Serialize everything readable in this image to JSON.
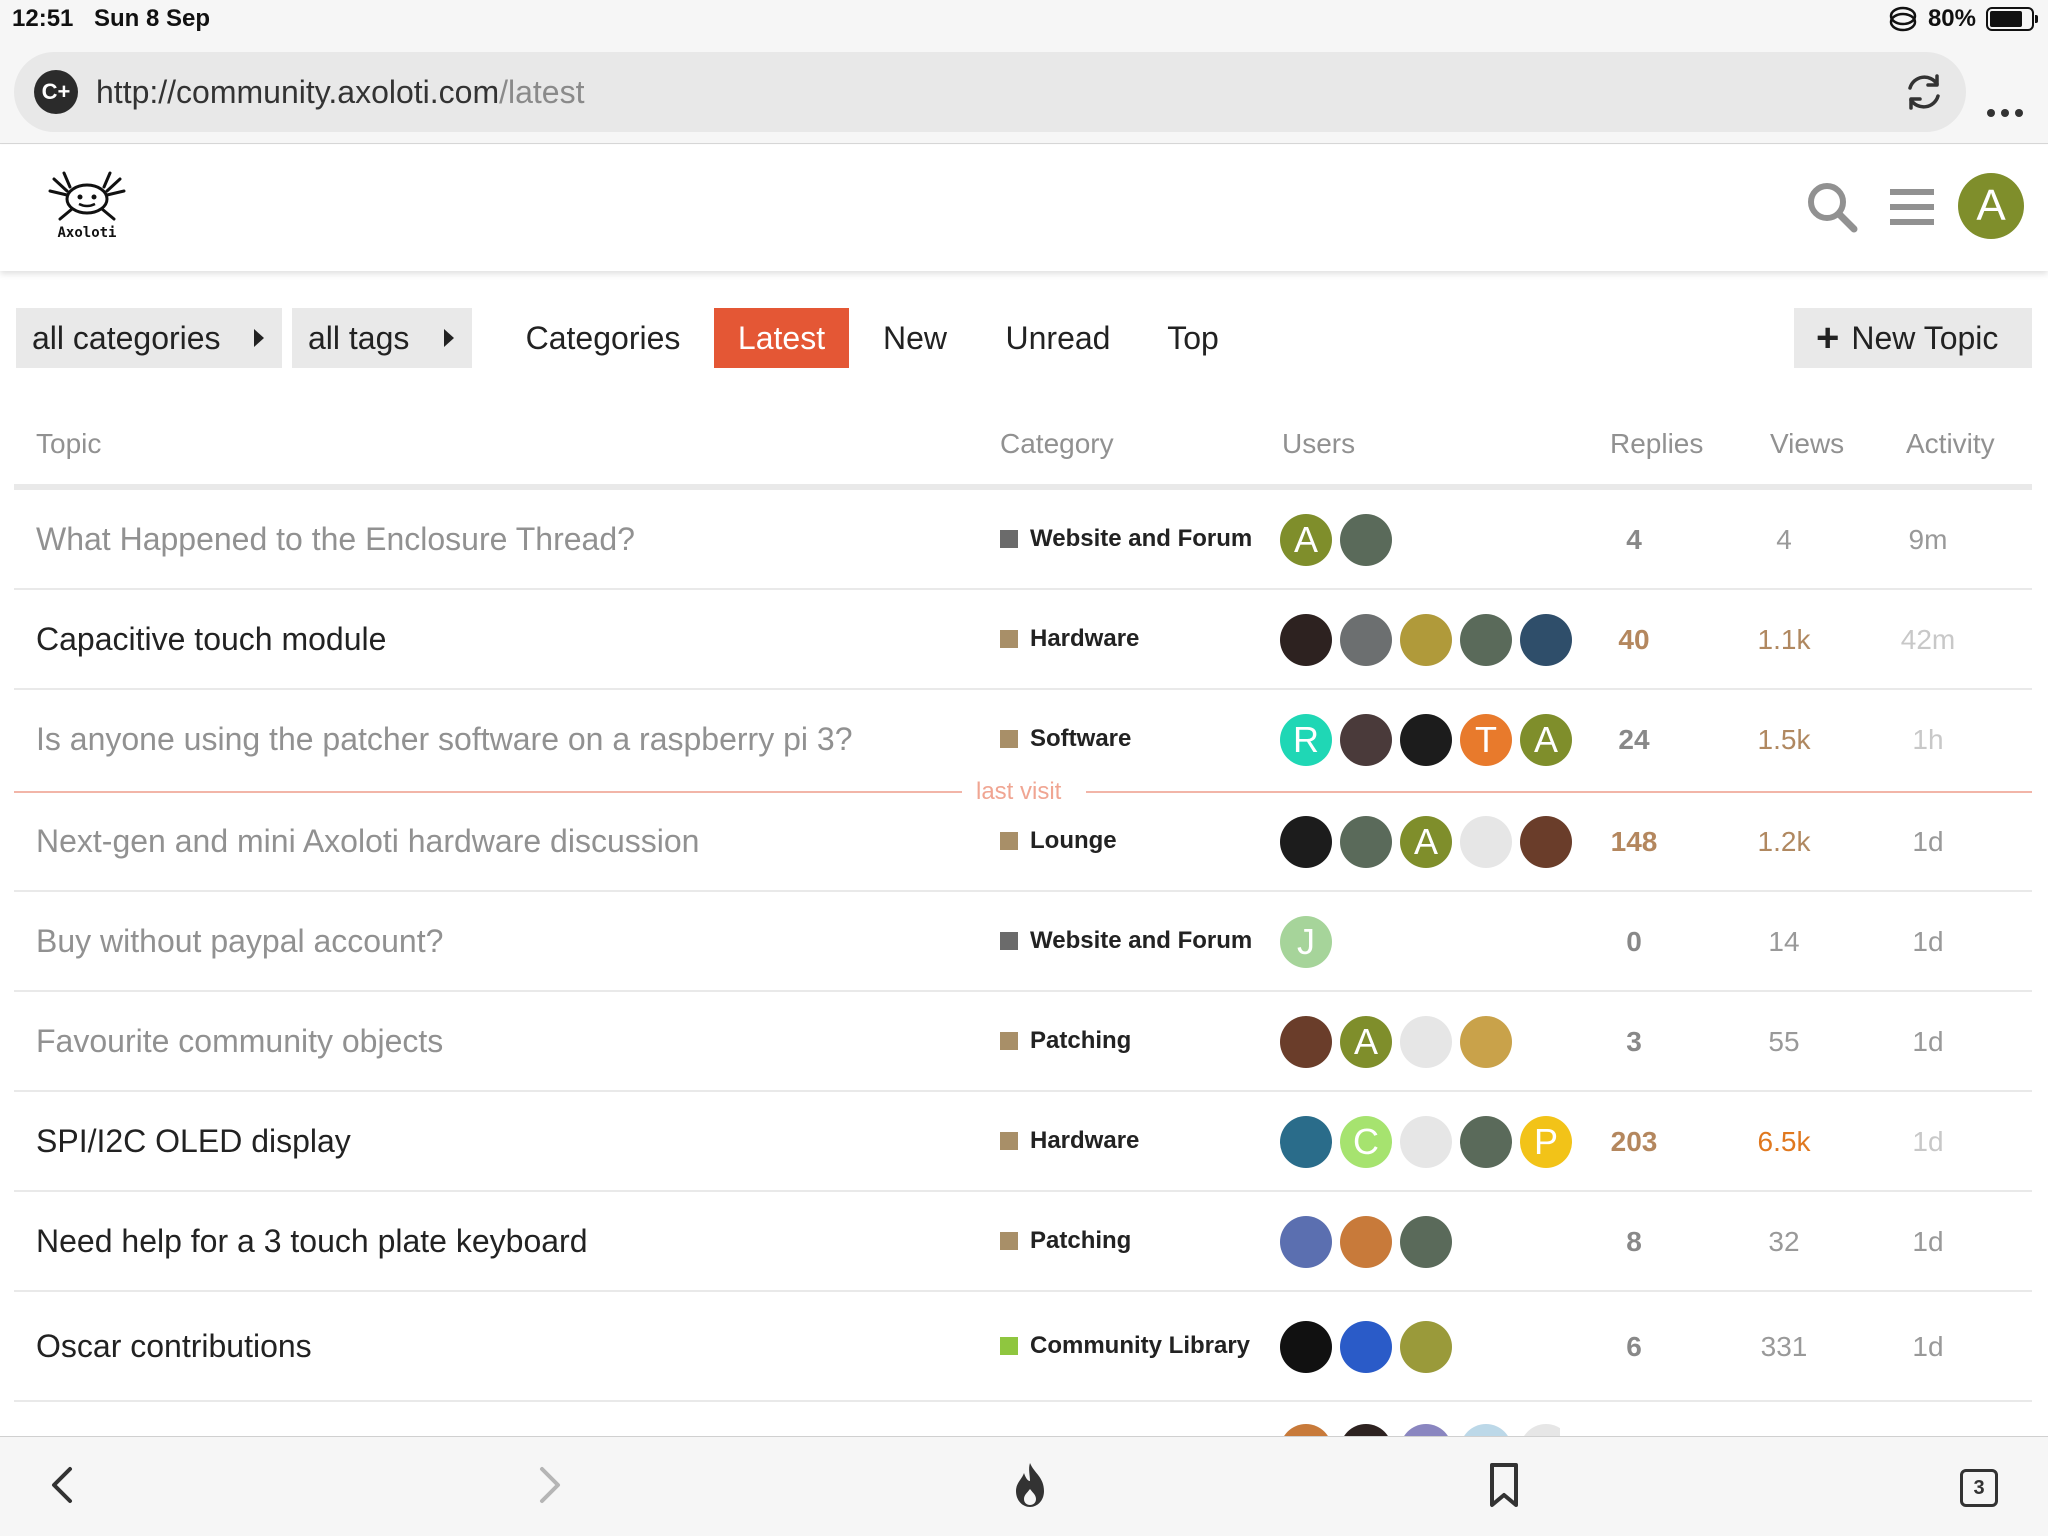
{
  "status_bar": {
    "time": "12:51",
    "date": "Sun 8 Sep",
    "battery": "80%"
  },
  "browser": {
    "url_host": "http://community.axoloti.com",
    "url_path": "/latest",
    "logo": "C+"
  },
  "header": {
    "brand": "Axoloti",
    "user_initial": "A",
    "user_color": "#7f8e2b"
  },
  "nav": {
    "categories_dropdown": "all categories",
    "tags_dropdown": "all tags",
    "tabs": [
      {
        "label": "Categories",
        "active": false
      },
      {
        "label": "Latest",
        "active": true
      },
      {
        "label": "New",
        "active": false
      },
      {
        "label": "Unread",
        "active": false
      },
      {
        "label": "Top",
        "active": false
      }
    ],
    "new_topic": "New Topic",
    "accent": "#e45735"
  },
  "columns": {
    "topic": "Topic",
    "category": "Category",
    "users": "Users",
    "replies": "Replies",
    "views": "Views",
    "activity": "Activity"
  },
  "last_visit_label": "last visit",
  "topics": [
    {
      "title": "What Happened to the Enclosure Thread?",
      "read": true,
      "category": "Website and Forum",
      "cat_color": "#6b6b6b",
      "users": [
        {
          "initial": "A",
          "color": "#7f8e2b"
        },
        {
          "initial": "",
          "color": "#5a6a5a"
        }
      ],
      "replies": "4",
      "replies_color": "#888888",
      "views": "4",
      "views_color": "#999999",
      "activity": "9m",
      "activity_color": "#999999"
    },
    {
      "title": "Capacitive touch module",
      "read": false,
      "category": "Hardware",
      "cat_color": "#a88f68",
      "users": [
        {
          "initial": "",
          "color": "#2d2220"
        },
        {
          "initial": "",
          "color": "#6c6f70"
        },
        {
          "initial": "",
          "color": "#b09a3a"
        },
        {
          "initial": "",
          "color": "#5a6a5a"
        },
        {
          "initial": "",
          "color": "#2f4e6a"
        }
      ],
      "replies": "40",
      "replies_color": "#b4875e",
      "views": "1.1k",
      "views_color": "#b08860",
      "activity": "42m",
      "activity_color": "#c8c8c8"
    },
    {
      "title": "Is anyone using the patcher software on a raspberry pi 3?",
      "read": true,
      "category": "Software",
      "cat_color": "#a88f68",
      "users": [
        {
          "initial": "R",
          "color": "#1fd7b5"
        },
        {
          "initial": "",
          "color": "#4a3a3a"
        },
        {
          "initial": "",
          "color": "#1c1c1c"
        },
        {
          "initial": "T",
          "color": "#e87a2c"
        },
        {
          "initial": "A",
          "color": "#7f8e2b"
        }
      ],
      "replies": "24",
      "replies_color": "#888888",
      "views": "1.5k",
      "views_color": "#b08860",
      "activity": "1h",
      "activity_color": "#c8c8c8"
    },
    {
      "title": "Next-gen and mini Axoloti hardware discussion",
      "read": true,
      "category": "Lounge",
      "cat_color": "#a88f68",
      "users": [
        {
          "initial": "",
          "color": "#1c1c1c"
        },
        {
          "initial": "",
          "color": "#5a6a5a"
        },
        {
          "initial": "A",
          "color": "#7f8e2b"
        },
        {
          "initial": "",
          "color": "#e6e6e6"
        },
        {
          "initial": "",
          "color": "#6a3d2a"
        }
      ],
      "replies": "148",
      "replies_color": "#b4875e",
      "views": "1.2k",
      "views_color": "#b08860",
      "activity": "1d",
      "activity_color": "#999999"
    },
    {
      "title": "Buy without paypal account?",
      "read": true,
      "category": "Website and Forum",
      "cat_color": "#6b6b6b",
      "users": [
        {
          "initial": "J",
          "color": "#a6d49a"
        }
      ],
      "replies": "0",
      "replies_color": "#888888",
      "views": "14",
      "views_color": "#999999",
      "activity": "1d",
      "activity_color": "#999999"
    },
    {
      "title": "Favourite community objects",
      "read": true,
      "category": "Patching",
      "cat_color": "#a88f68",
      "users": [
        {
          "initial": "",
          "color": "#6a3d2a"
        },
        {
          "initial": "A",
          "color": "#7f8e2b"
        },
        {
          "initial": "",
          "color": "#e6e6e6"
        },
        {
          "initial": "",
          "color": "#c9a24a"
        }
      ],
      "replies": "3",
      "replies_color": "#888888",
      "views": "55",
      "views_color": "#999999",
      "activity": "1d",
      "activity_color": "#999999"
    },
    {
      "title": "SPI/I2C OLED display",
      "read": false,
      "category": "Hardware",
      "cat_color": "#a88f68",
      "users": [
        {
          "initial": "",
          "color": "#2a6c8a"
        },
        {
          "initial": "C",
          "color": "#a6e36f"
        },
        {
          "initial": "",
          "color": "#e6e6e6"
        },
        {
          "initial": "",
          "color": "#5a6a5a"
        },
        {
          "initial": "P",
          "color": "#f2c318"
        }
      ],
      "replies": "203",
      "replies_color": "#b4875e",
      "views": "6.5k",
      "views_color": "#e0781e",
      "activity": "1d",
      "activity_color": "#c8c8c8"
    },
    {
      "title": "Need help for a 3 touch plate keyboard",
      "read": false,
      "category": "Patching",
      "cat_color": "#a88f68",
      "users": [
        {
          "initial": "",
          "color": "#5b6fb0"
        },
        {
          "initial": "",
          "color": "#c87a3a"
        },
        {
          "initial": "",
          "color": "#5a6a5a"
        }
      ],
      "replies": "8",
      "replies_color": "#888888",
      "views": "32",
      "views_color": "#999999",
      "activity": "1d",
      "activity_color": "#999999"
    },
    {
      "title": "Oscar contributions",
      "read": false,
      "category": "Community Library",
      "cat_color": "#8fc63f",
      "users": [
        {
          "initial": "",
          "color": "#111111"
        },
        {
          "initial": "",
          "color": "#2a5bc8"
        },
        {
          "initial": "",
          "color": "#9a9a3a"
        }
      ],
      "replies": "6",
      "replies_color": "#888888",
      "views": "331",
      "views_color": "#999999",
      "activity": "1d",
      "activity_color": "#999999"
    }
  ],
  "bottom_bar": {
    "tab_count": "3"
  }
}
